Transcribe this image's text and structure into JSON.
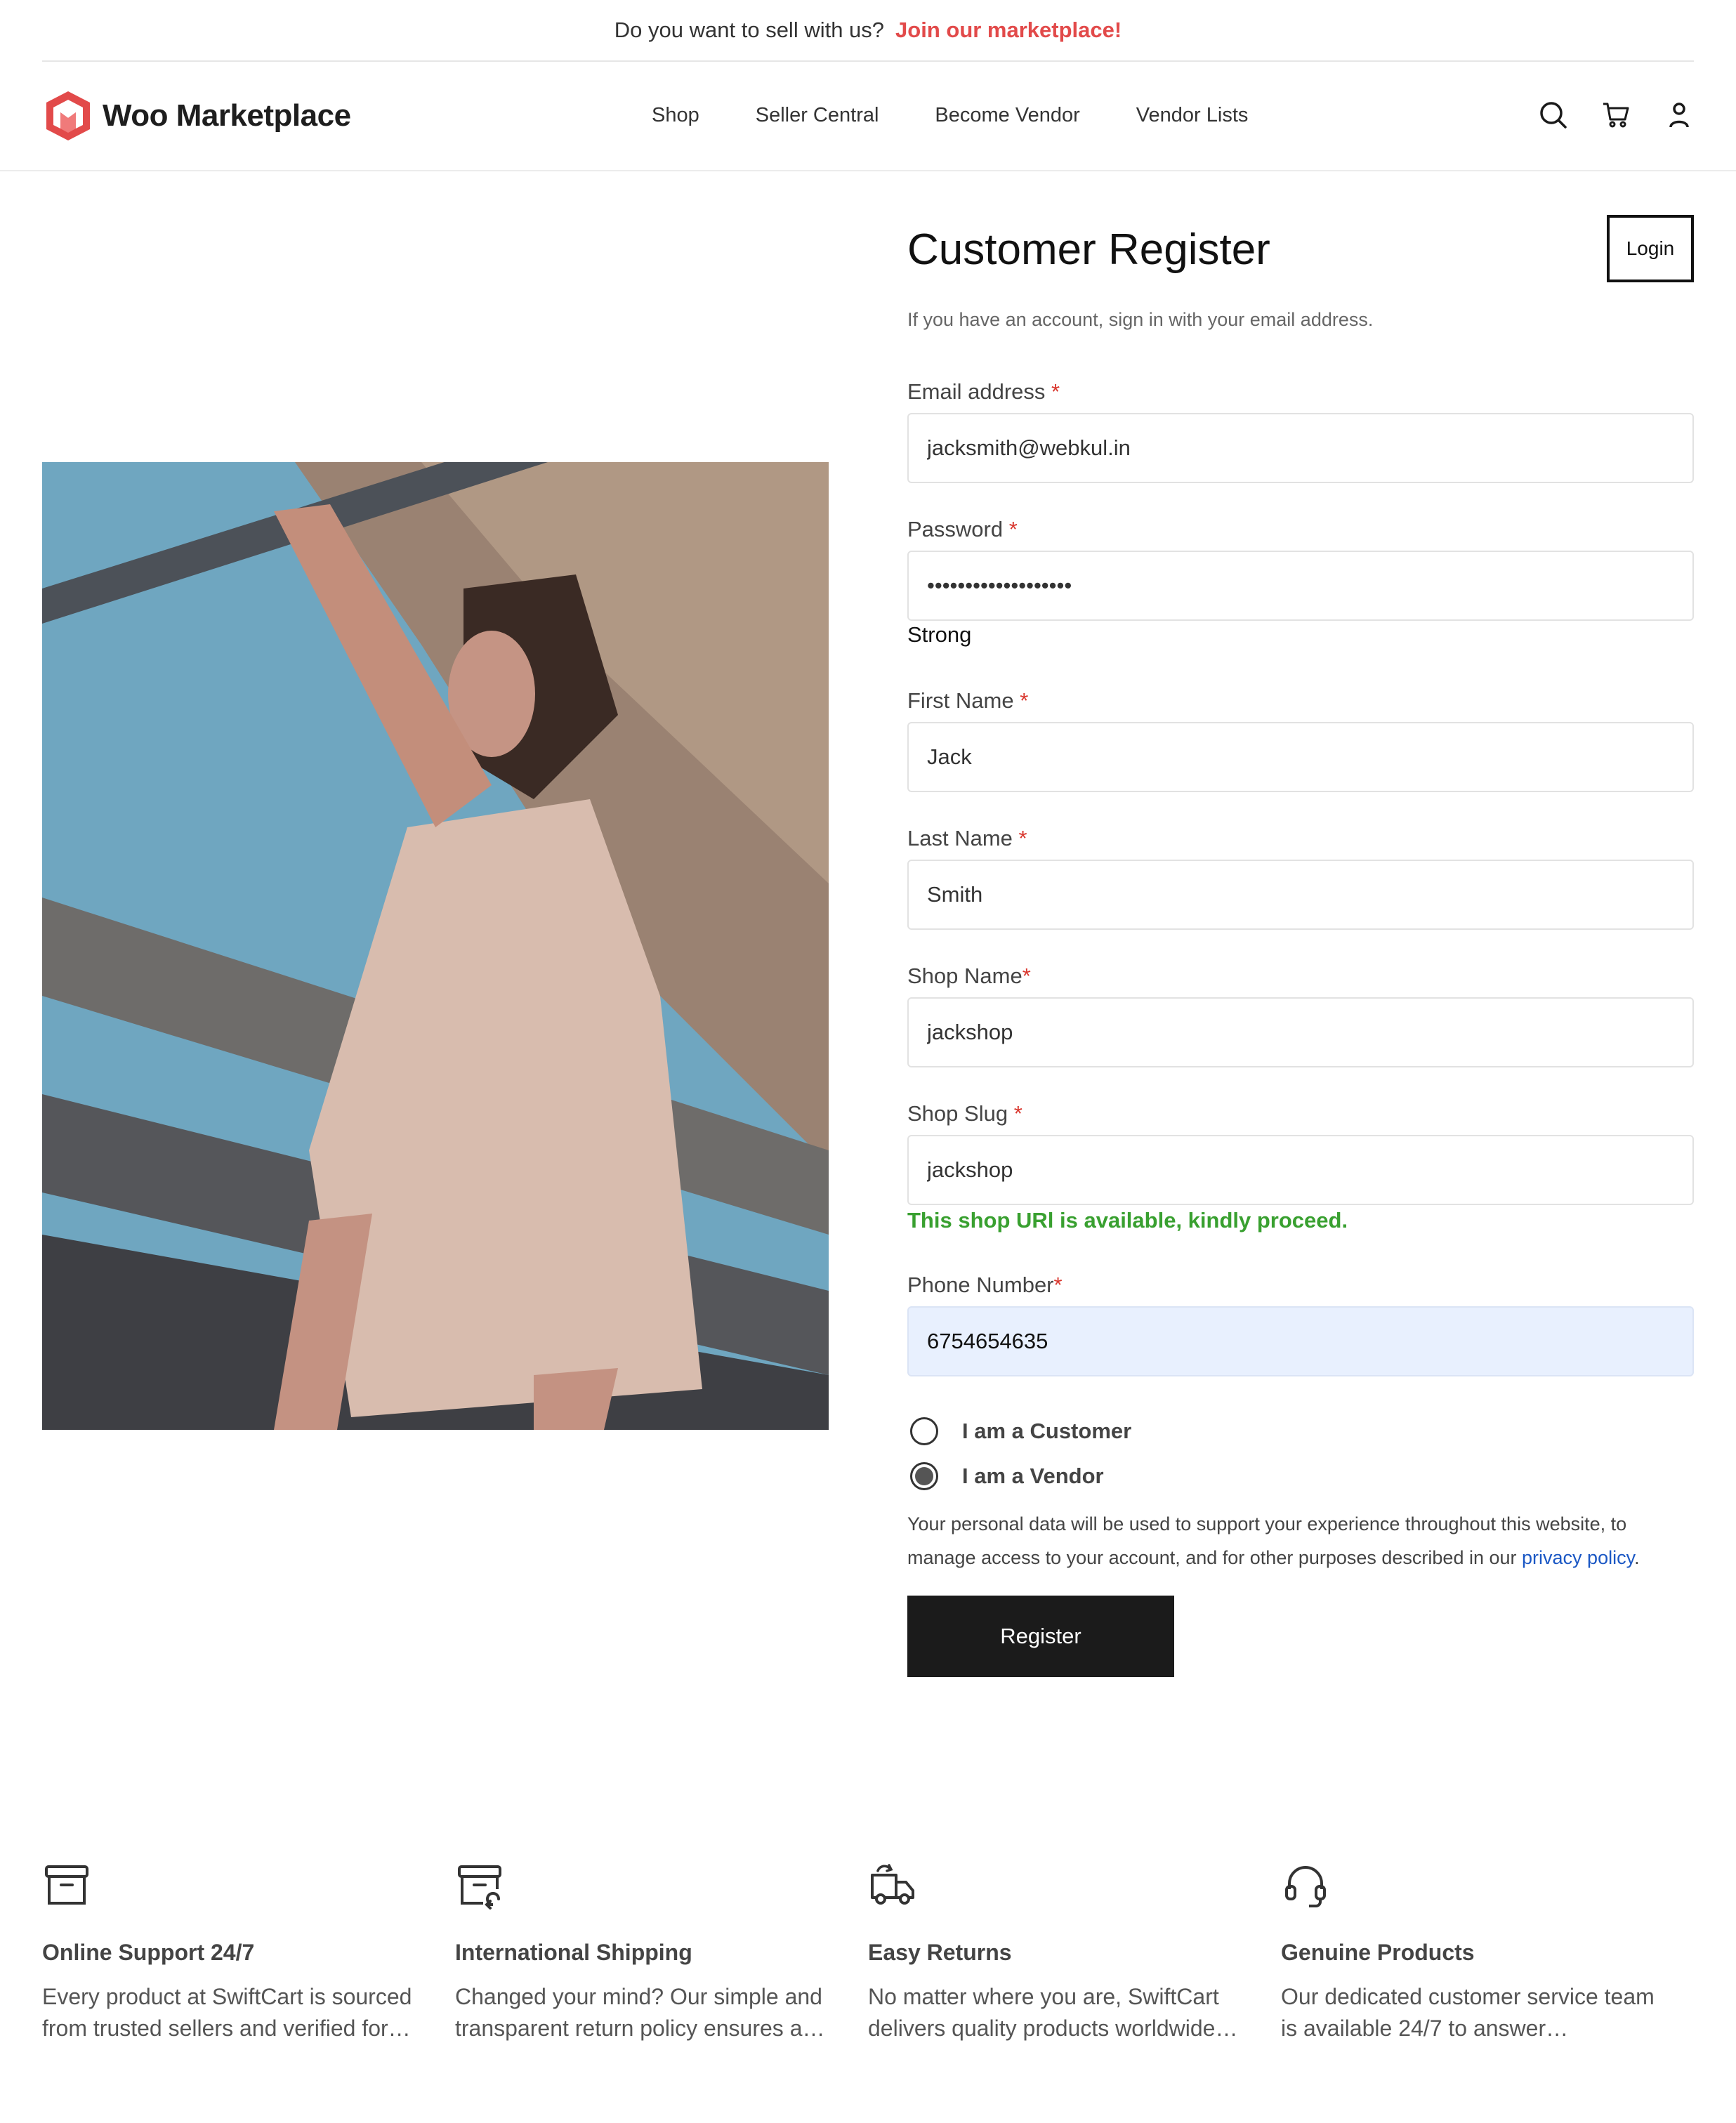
{
  "announcement": {
    "question": "Do you want to sell with us?",
    "link": "Join our marketplace!"
  },
  "brand": {
    "name": "Woo Marketplace",
    "logo_color": "#e24a4a"
  },
  "nav": {
    "items": [
      "Shop",
      "Seller Central",
      "Become Vendor",
      "Vendor Lists"
    ]
  },
  "header_icons": [
    "search-icon",
    "cart-icon",
    "user-icon"
  ],
  "form": {
    "title": "Customer Register",
    "login_label": "Login",
    "subtitle": "If you have an account, sign in with your email address.",
    "email": {
      "label": "Email address",
      "required": "*",
      "value": "jacksmith@webkul.in"
    },
    "password": {
      "label": "Password",
      "required": "*",
      "value": "•••••••••••••••••••",
      "strength": "Strong"
    },
    "first_name": {
      "label": "First Name",
      "required": "*",
      "value": "Jack"
    },
    "last_name": {
      "label": "Last Name",
      "required": "*",
      "value": "Smith"
    },
    "shop_name": {
      "label": "Shop Name",
      "required": "*",
      "value": "jackshop"
    },
    "shop_slug": {
      "label": "Shop Slug",
      "required": "*",
      "value": "jackshop",
      "status": "This shop URl is available, kindly proceed."
    },
    "phone": {
      "label": "Phone Number",
      "required": "*",
      "value": "6754654635"
    },
    "role_customer": "I am a Customer",
    "role_vendor": "I am a Vendor",
    "selected_role": "vendor",
    "privacy_text": "Your personal data will be used to support your experience throughout this website, to manage access to your account, and for other purposes described in our",
    "privacy_link": "privacy policy",
    "privacy_end": ".",
    "register_label": "Register"
  },
  "features": [
    {
      "icon": "archive-icon",
      "title": "Online Support 24/7",
      "text": "Every product at SwiftCart is sourced from trusted sellers and verified for…"
    },
    {
      "icon": "return-box-icon",
      "title": "International Shipping",
      "text": "Changed your mind? Our simple and transparent return policy ensures a…"
    },
    {
      "icon": "truck-icon",
      "title": "Easy Returns",
      "text": "No matter where you are, SwiftCart delivers quality products worldwide…"
    },
    {
      "icon": "headset-icon",
      "title": "Genuine Products",
      "text": "Our dedicated customer service team is available 24/7 to answer…"
    }
  ],
  "colors": {
    "accent": "#e24a4a",
    "success": "#39a030",
    "link": "#1a57c4",
    "button": "#1b1b1b",
    "autofill": "#e8f0fe"
  }
}
